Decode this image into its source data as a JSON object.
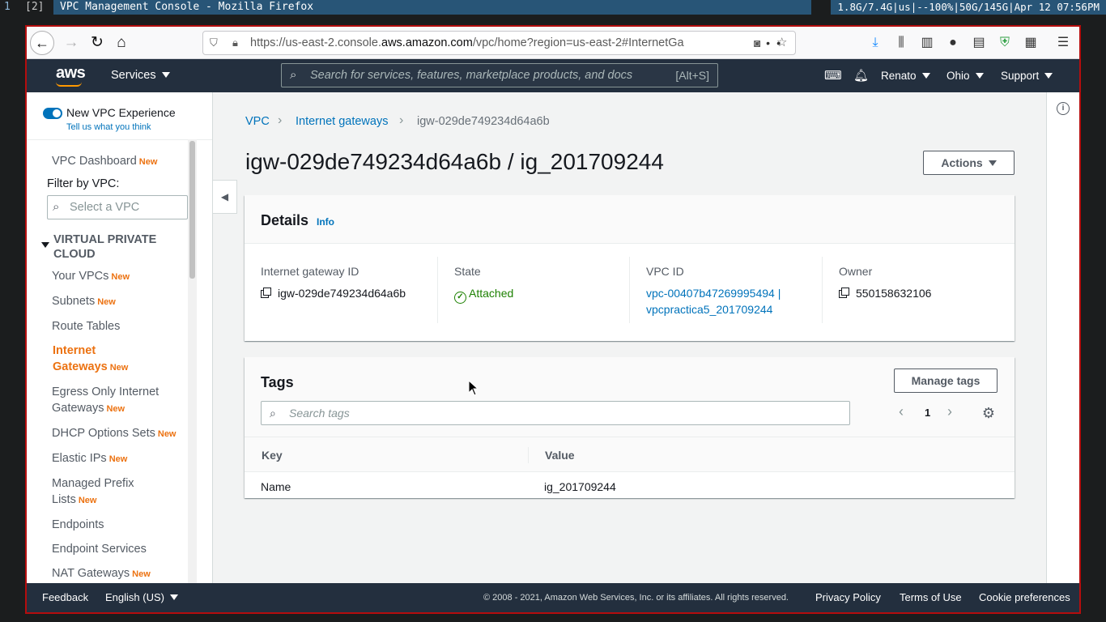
{
  "sysbar": {
    "workspace_1": "1",
    "workspace_2": "[2]",
    "window_title": "VPC Management Console - Mozilla Firefox",
    "status": "1.8G/7.4G|us|--100%|50G/145G|Apr 12 07:56PM"
  },
  "browser": {
    "url_prefix": "https://us-east-2.console.",
    "url_domain": "aws.amazon.com",
    "url_suffix": "/vpc/home?region=us-east-2#InternetGa",
    "page_actions": "•••"
  },
  "aws_nav": {
    "logo": "aws",
    "services_label": "Services",
    "search_placeholder": "Search for services, features, marketplace products, and docs",
    "search_shortcut": "[Alt+S]",
    "user": "Renato",
    "region": "Ohio",
    "support": "Support"
  },
  "sidebar": {
    "new_experience": "New VPC Experience",
    "tell_us": "Tell us what you think",
    "dashboard": "VPC Dashboard",
    "new_badge": "New",
    "filter_label": "Filter by VPC:",
    "select_placeholder": "Select a VPC",
    "section_title": "VIRTUAL PRIVATE CLOUD",
    "items": [
      {
        "label": "Your VPCs",
        "badge": "New"
      },
      {
        "label": "Subnets",
        "badge": "New"
      },
      {
        "label": "Route Tables",
        "badge": ""
      },
      {
        "label": "Internet Gateways",
        "badge": "New"
      },
      {
        "label": "Egress Only Internet Gateways",
        "badge": "New"
      },
      {
        "label": "DHCP Options Sets",
        "badge": "New"
      },
      {
        "label": "Elastic IPs",
        "badge": "New"
      },
      {
        "label": "Managed Prefix Lists",
        "badge": "New"
      },
      {
        "label": "Endpoints",
        "badge": ""
      },
      {
        "label": "Endpoint Services",
        "badge": ""
      },
      {
        "label": "NAT Gateways",
        "badge": "New"
      }
    ]
  },
  "breadcrumb": {
    "vpc": "VPC",
    "internet_gateways": "Internet gateways",
    "current": "igw-029de749234d64a6b"
  },
  "page": {
    "title": "igw-029de749234d64a6b / ig_201709244",
    "actions": "Actions"
  },
  "details": {
    "title": "Details",
    "info": "Info",
    "igw_label": "Internet gateway ID",
    "igw_value": "igw-029de749234d64a6b",
    "state_label": "State",
    "state_value": "Attached",
    "vpc_label": "VPC ID",
    "vpc_value_1": "vpc-00407b47269995494 |",
    "vpc_value_2": "vpcpractica5_201709244",
    "owner_label": "Owner",
    "owner_value": "550158632106"
  },
  "tags": {
    "title": "Tags",
    "manage": "Manage tags",
    "search_placeholder": "Search tags",
    "page": "1",
    "col_key": "Key",
    "col_value": "Value",
    "rows": [
      {
        "key": "Name",
        "value": "ig_201709244"
      }
    ]
  },
  "footer": {
    "feedback": "Feedback",
    "language": "English (US)",
    "copyright": "© 2008 - 2021, Amazon Web Services, Inc. or its affiliates. All rights reserved.",
    "privacy": "Privacy Policy",
    "terms": "Terms of Use",
    "cookies": "Cookie preferences"
  },
  "colors": {
    "aws_nav_bg": "#232f3e",
    "link": "#0073bb",
    "accent_orange": "#ec7211",
    "success_green": "#1d8102",
    "frame_border": "#b50d0d"
  }
}
